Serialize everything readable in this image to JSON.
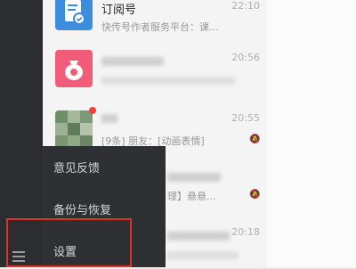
{
  "chat_list": [
    {
      "name": "订阅号",
      "preview": "快传号作者服务平台：课...",
      "time": "22:10",
      "avatar_color": "#3c8dde"
    },
    {
      "name": "",
      "preview": "",
      "time": "20:56",
      "avatar_color": "#f25c78"
    },
    {
      "name": "",
      "preview": "[9条] 朋友：[动画表情]",
      "time": "20:55",
      "avatar_color": "#7aa07a"
    },
    {
      "name": "",
      "preview": "理】悬悬...",
      "time": "",
      "avatar_color": "#c8c8c8"
    },
    {
      "name": "",
      "preview": "",
      "time": "20:18",
      "avatar_color": "#c8c8c8"
    }
  ],
  "settings_menu": {
    "feedback": "意见反馈",
    "backup": "备份与恢复",
    "settings": "设置"
  },
  "colors": {
    "highlight": "#d9342b",
    "sidebar": "#2b2d31",
    "menu": "#2f3034"
  }
}
